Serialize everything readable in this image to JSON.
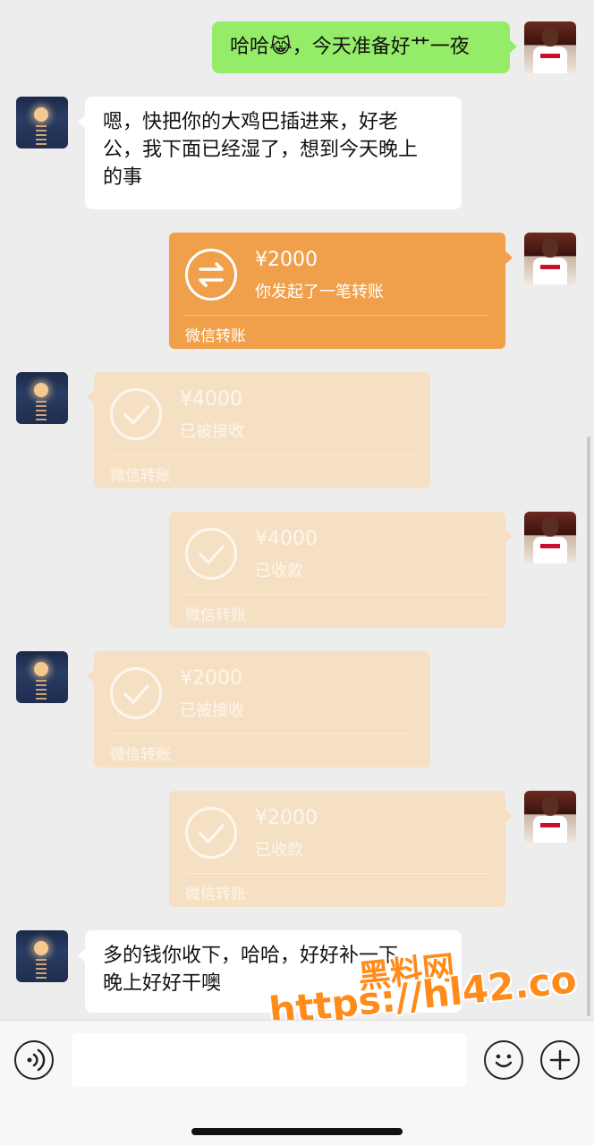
{
  "messages": {
    "m1": {
      "sender": "self",
      "text": "哈哈😹，今天准备好艹一夜"
    },
    "m2": {
      "sender": "other",
      "line1": "嗯，快把你的大鸡巴插进来，好老",
      "line2": "公，我下面已经湿了，想到今天晚上",
      "line3": "的事"
    },
    "t1": {
      "sender": "self",
      "amount": "¥2000",
      "status": "你发起了一笔转账",
      "label": "微信转账"
    },
    "t2": {
      "sender": "other",
      "amount": "¥4000",
      "status": "已被接收",
      "label": "微信转账"
    },
    "t3": {
      "sender": "self",
      "amount": "¥4000",
      "status": "已收款",
      "label": "微信转账"
    },
    "t4": {
      "sender": "other",
      "amount": "¥2000",
      "status": "已被接收",
      "label": "微信转账"
    },
    "t5": {
      "sender": "self",
      "amount": "¥2000",
      "status": "已收款",
      "label": "微信转账"
    },
    "m3": {
      "sender": "other",
      "line1": "多的钱你收下，哈哈，好好补一下，",
      "line2": "晚上好好干噢"
    }
  },
  "watermark": {
    "line1": "黑料网",
    "line2": "https://hl42.co"
  },
  "icons": {
    "voice": "voice-icon",
    "emoji": "emoji-icon",
    "plus": "plus-icon",
    "transfer_pending": "transfer-arrows-icon",
    "transfer_done": "checkmark-icon"
  },
  "colors": {
    "self_bubble": "#95ec69",
    "other_bubble": "#ffffff",
    "transfer_active": "#f0a04b",
    "transfer_done": "#f6e0c4",
    "background": "#ededed"
  }
}
